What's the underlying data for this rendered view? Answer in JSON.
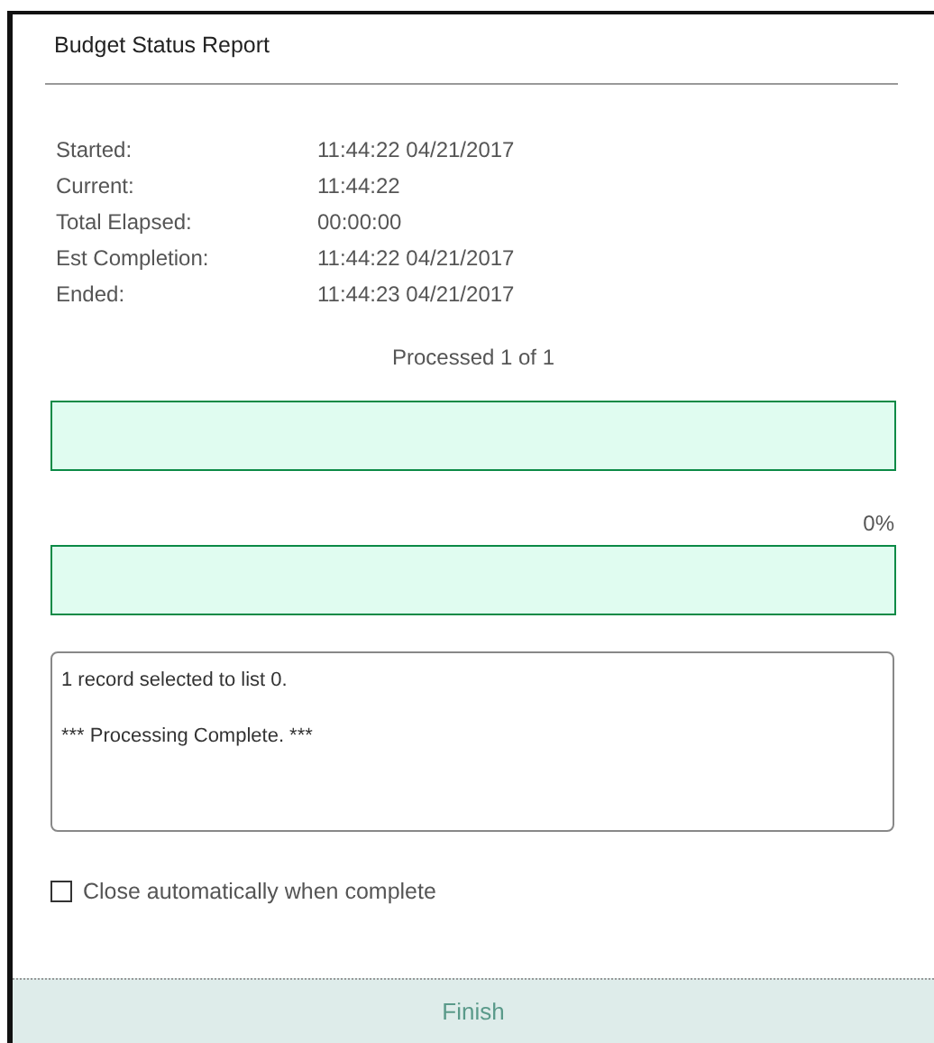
{
  "window": {
    "title": "Budget Status Report"
  },
  "times": [
    {
      "label": "Started:",
      "value": "11:44:22 04/21/2017"
    },
    {
      "label": "Current:",
      "value": "11:44:22"
    },
    {
      "label": "Total Elapsed:",
      "value": "00:00:00"
    },
    {
      "label": "Est Completion:",
      "value": "11:44:22 04/21/2017"
    },
    {
      "label": "Ended:",
      "value": "11:44:23 04/21/2017"
    }
  ],
  "processed": "Processed 1 of 1",
  "progress_bars": [
    {
      "level": 0
    },
    {
      "caption": "0%",
      "level": 0
    }
  ],
  "log": [
    "1 record selected to list 0.",
    "*** Processing Complete. ***"
  ],
  "close_automatically": {
    "label": "Close automatically when complete",
    "checked": false
  },
  "finish_button": "Finish"
}
